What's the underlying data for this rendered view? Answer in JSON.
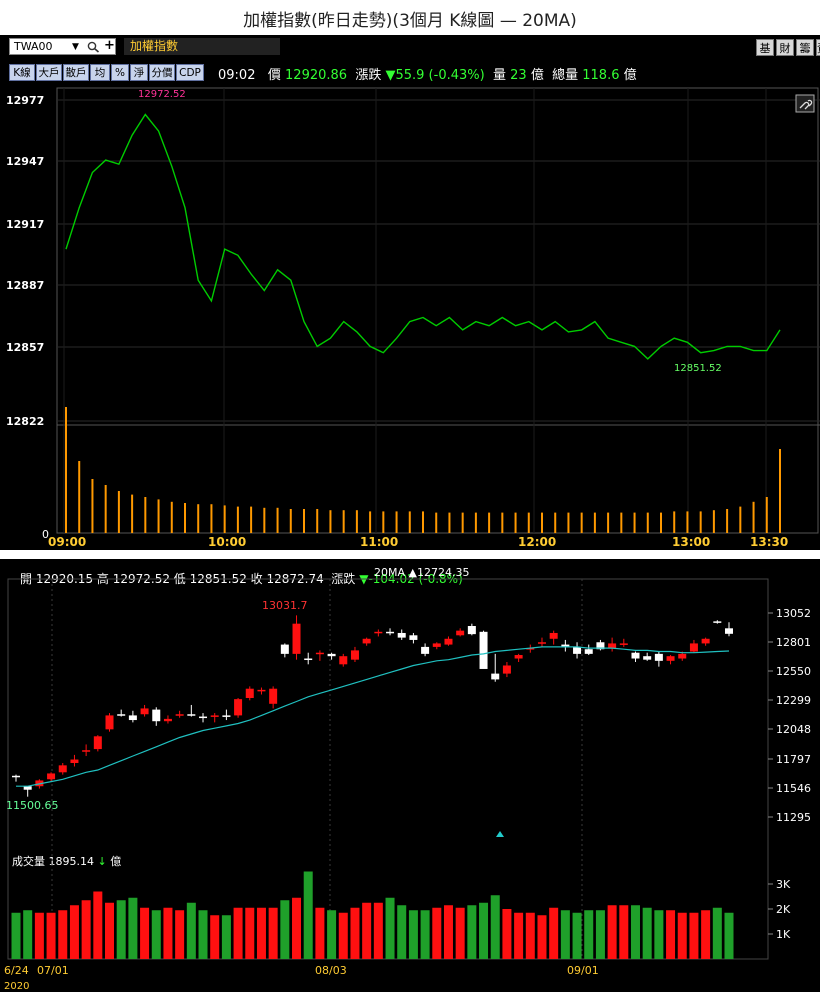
{
  "title": "加權指數(昨日走勢)(3個月 K線圖 — 20MA)",
  "toolbar": {
    "symbol": "TWA00",
    "dropdown_icon": "▼",
    "search_icon": "magnifier",
    "add_icon": "+",
    "name": "加權指數",
    "right_buttons": [
      "基",
      "財",
      "籌",
      "資"
    ],
    "left_buttons": [
      "K線",
      "大戶",
      "散戶",
      "均",
      "%",
      "淨",
      "分價",
      "CDP"
    ]
  },
  "quote": {
    "time": "09:02",
    "price_label": "價",
    "price": "12920.86",
    "change_label": "漲跌",
    "change": "▼55.9 (-0.43%)",
    "volume_label": "量",
    "volume": "23",
    "volume_unit": "億",
    "total_label": "總量",
    "total": "118.6",
    "total_unit": "億"
  },
  "intraday": {
    "y_ticks": [
      "12977",
      "12947",
      "12917",
      "12887",
      "12857",
      "12822"
    ],
    "x_ticks": [
      "09:00",
      "10:00",
      "11:00",
      "12:00",
      "13:00",
      "13:30"
    ],
    "high_label": "12972.52",
    "low_label": "12851.52",
    "vol_zero": "0",
    "link_icon": "link"
  },
  "kline": {
    "ohlc_text": "開 12920.15 高 12972.52 低 12851.52 收 12872.74",
    "change_label": "漲跌",
    "change_value": "▼-104.02 (-0.8%)",
    "ma_label": "20MA",
    "ma_value": "▲12724.35",
    "y_ticks": [
      "13052",
      "12801",
      "12550",
      "12299",
      "12048",
      "11797",
      "11546",
      "11295"
    ],
    "high_label": "13031.7",
    "low_label": "11500.65",
    "vol_label": "成交量",
    "vol_value": "1895.14",
    "vol_arrow": "↓",
    "vol_unit": "億",
    "vol_ticks": [
      "3K",
      "2K",
      "1K"
    ],
    "x_ticks": [
      "6/24",
      "07/01",
      "08/03",
      "09/01"
    ],
    "year": "2020"
  },
  "chart_data": [
    {
      "type": "line",
      "title": "",
      "x": [
        "09:00",
        "09:05",
        "09:10",
        "09:15",
        "09:20",
        "09:25",
        "09:30",
        "09:35",
        "09:40",
        "09:45",
        "09:50",
        "09:55",
        "10:00",
        "10:05",
        "10:10",
        "10:15",
        "10:20",
        "10:25",
        "10:30",
        "10:35",
        "10:40",
        "10:45",
        "10:50",
        "10:55",
        "11:00",
        "11:05",
        "11:10",
        "11:15",
        "11:20",
        "11:25",
        "11:30",
        "11:35",
        "11:40",
        "11:45",
        "11:50",
        "11:55",
        "12:00",
        "12:05",
        "12:10",
        "12:15",
        "12:20",
        "12:25",
        "12:30",
        "12:35",
        "12:40",
        "12:45",
        "12:50",
        "12:55",
        "13:00",
        "13:05",
        "13:10",
        "13:15",
        "13:20",
        "13:25",
        "13:30"
      ],
      "values": [
        12905,
        12925,
        12942,
        12948,
        12946,
        12960,
        12970,
        12962,
        12945,
        12925,
        12890,
        12880,
        12905,
        12902,
        12893,
        12885,
        12895,
        12890,
        12870,
        12858,
        12862,
        12870,
        12865,
        12858,
        12855,
        12862,
        12870,
        12872,
        12868,
        12872,
        12866,
        12870,
        12868,
        12872,
        12868,
        12870,
        12866,
        12870,
        12865,
        12866,
        12870,
        12862,
        12860,
        12858,
        12852,
        12858,
        12862,
        12860,
        12855,
        12856,
        12858,
        12858,
        12856,
        12856,
        12866
      ],
      "ylim": [
        12822,
        12977
      ],
      "high": 12972.52,
      "low": 12851.52,
      "volume": [
        105,
        60,
        45,
        40,
        35,
        32,
        30,
        28,
        26,
        25,
        24,
        24,
        23,
        22,
        22,
        21,
        21,
        20,
        20,
        20,
        19,
        19,
        19,
        18,
        18,
        18,
        18,
        18,
        17,
        17,
        17,
        17,
        17,
        17,
        17,
        17,
        17,
        17,
        17,
        17,
        17,
        17,
        17,
        17,
        17,
        17,
        18,
        18,
        18,
        19,
        20,
        22,
        26,
        30,
        70
      ],
      "volume_max": 80,
      "series_color": "#00cc00",
      "volume_color": "#ff9900"
    },
    {
      "type": "bar",
      "title": "",
      "ylim": [
        11295,
        13052
      ],
      "x_ticks": [
        "6/24",
        "07/01",
        "08/03",
        "09/01"
      ],
      "ohlc": [
        [
          11650,
          11660,
          11600,
          11640
        ],
        [
          11560,
          11560,
          11470,
          11530
        ],
        [
          11560,
          11620,
          11540,
          11610
        ],
        [
          11620,
          11680,
          11600,
          11670
        ],
        [
          11680,
          11760,
          11660,
          11740
        ],
        [
          11760,
          11830,
          11730,
          11790
        ],
        [
          11860,
          11920,
          11820,
          11870
        ],
        [
          11880,
          12000,
          11860,
          11990
        ],
        [
          12050,
          12190,
          12030,
          12170
        ],
        [
          12180,
          12220,
          12160,
          12170
        ],
        [
          12170,
          12210,
          12110,
          12130
        ],
        [
          12180,
          12260,
          12160,
          12230
        ],
        [
          12220,
          12240,
          12080,
          12120
        ],
        [
          12120,
          12170,
          12100,
          12140
        ],
        [
          12170,
          12210,
          12150,
          12180
        ],
        [
          12180,
          12260,
          12160,
          12170
        ],
        [
          12160,
          12190,
          12110,
          12150
        ],
        [
          12160,
          12190,
          12110,
          12170
        ],
        [
          12170,
          12220,
          12130,
          12160
        ],
        [
          12170,
          12320,
          12150,
          12310
        ],
        [
          12320,
          12420,
          12300,
          12400
        ],
        [
          12380,
          12410,
          12350,
          12390
        ],
        [
          12270,
          12420,
          12230,
          12400
        ],
        [
          12780,
          12790,
          12670,
          12700
        ],
        [
          12700,
          13031.7,
          12650,
          12960
        ],
        [
          12660,
          12710,
          12610,
          12650
        ],
        [
          12700,
          12730,
          12640,
          12710
        ],
        [
          12700,
          12710,
          12650,
          12680
        ],
        [
          12610,
          12700,
          12590,
          12680
        ],
        [
          12650,
          12760,
          12630,
          12730
        ],
        [
          12790,
          12840,
          12770,
          12830
        ],
        [
          12880,
          12910,
          12850,
          12890
        ],
        [
          12890,
          12920,
          12860,
          12880
        ],
        [
          12880,
          12910,
          12820,
          12840
        ],
        [
          12860,
          12880,
          12790,
          12820
        ],
        [
          12760,
          12790,
          12680,
          12700
        ],
        [
          12760,
          12800,
          12740,
          12790
        ],
        [
          12780,
          12850,
          12770,
          12830
        ],
        [
          12860,
          12920,
          12850,
          12900
        ],
        [
          12940,
          12960,
          12860,
          12870
        ],
        [
          12890,
          12900,
          12680,
          12570
        ],
        [
          12530,
          12700,
          12460,
          12480
        ],
        [
          12530,
          12630,
          12500,
          12600
        ],
        [
          12660,
          12700,
          12630,
          12690
        ],
        [
          12740,
          12780,
          12710,
          12750
        ],
        [
          12790,
          12840,
          12760,
          12800
        ],
        [
          12830,
          12900,
          12780,
          12880
        ],
        [
          12780,
          12820,
          12720,
          12760
        ],
        [
          12760,
          12800,
          12660,
          12700
        ],
        [
          12740,
          12780,
          12690,
          12700
        ],
        [
          12800,
          12820,
          12730,
          12740
        ],
        [
          12750,
          12840,
          12720,
          12790
        ],
        [
          12780,
          12830,
          12760,
          12790
        ],
        [
          12710,
          12720,
          12630,
          12660
        ],
        [
          12680,
          12710,
          12640,
          12650
        ],
        [
          12700,
          12720,
          12590,
          12640
        ],
        [
          12640,
          12690,
          12610,
          12680
        ],
        [
          12660,
          12720,
          12640,
          12700
        ],
        [
          12720,
          12820,
          12710,
          12790
        ],
        [
          12790,
          12840,
          12770,
          12830
        ],
        [
          12980,
          12990,
          12960,
          12970
        ],
        [
          12920.15,
          12972.52,
          12851.52,
          12872.74
        ]
      ],
      "ma20": [
        11560,
        11560,
        11580,
        11600,
        11620,
        11650,
        11680,
        11700,
        11740,
        11780,
        11820,
        11860,
        11900,
        11940,
        11980,
        12010,
        12040,
        12060,
        12080,
        12100,
        12130,
        12170,
        12210,
        12250,
        12290,
        12330,
        12360,
        12390,
        12420,
        12450,
        12480,
        12510,
        12540,
        12570,
        12600,
        12620,
        12640,
        12650,
        12670,
        12690,
        12700,
        12720,
        12730,
        12740,
        12750,
        12760,
        12760,
        12760,
        12760,
        12750,
        12750,
        12750,
        12740,
        12730,
        12730,
        12720,
        12720,
        12710,
        12710,
        12715,
        12720,
        12724.35
      ],
      "volume": [
        1850,
        1950,
        1850,
        1850,
        1950,
        2150,
        2350,
        2700,
        2250,
        2350,
        2450,
        2050,
        1950,
        2050,
        1950,
        2250,
        1950,
        1750,
        1750,
        2050,
        2050,
        2050,
        2050,
        2350,
        2450,
        3500,
        2050,
        1950,
        1850,
        2050,
        2250,
        2250,
        2450,
        2150,
        1950,
        1950,
        2050,
        2150,
        2050,
        2150,
        2250,
        2550,
        2000,
        1850,
        1850,
        1750,
        2050,
        1950,
        1850,
        1950,
        1950,
        2150,
        2150,
        2150,
        2050,
        1950,
        1950,
        1850,
        1850,
        1950,
        2050,
        1850
      ],
      "vol_ylim": [
        0,
        4000
      ],
      "up_color": "#ff1010",
      "down_color": "#ffffff",
      "vol_up_color": "#ff1010",
      "vol_down_color": "#1fa02a",
      "ma_color": "#20c0c0"
    }
  ]
}
